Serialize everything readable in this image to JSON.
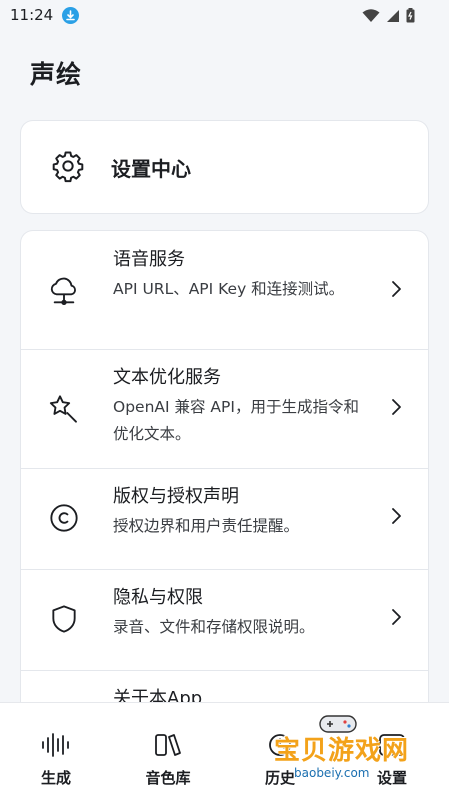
{
  "status_bar": {
    "time": "11:24"
  },
  "app": {
    "title": "声绘"
  },
  "settings_card": {
    "label": "设置中心",
    "icon": "gear-icon"
  },
  "items": [
    {
      "title": "语音服务",
      "desc": "API URL、API Key 和连接测试。",
      "icon": "cloud-network-icon"
    },
    {
      "title": "文本优化服务",
      "desc": "OpenAI 兼容 API，用于生成指令和优化文本。",
      "icon": "magic-star-icon"
    },
    {
      "title": "版权与授权声明",
      "desc": "授权边界和用户责任提醒。",
      "icon": "copyright-icon"
    },
    {
      "title": "隐私与权限",
      "desc": "录音、文件和存储权限说明。",
      "icon": "shield-icon"
    },
    {
      "title": "关于本App",
      "desc": "",
      "icon": "info-icon"
    }
  ],
  "nav": [
    {
      "label": "生成",
      "icon": "waveform-icon"
    },
    {
      "label": "音色库",
      "icon": "library-icon"
    },
    {
      "label": "历史",
      "icon": "history-icon"
    },
    {
      "label": "设置",
      "icon": "settings-icon"
    }
  ],
  "watermark": {
    "text": "宝贝游戏网",
    "url": "baobeiy.com"
  },
  "colors": {
    "accent": "#1c1e22",
    "background": "#f4f6f9",
    "card": "#ffffff",
    "download_badge": "#2aa0e6"
  }
}
